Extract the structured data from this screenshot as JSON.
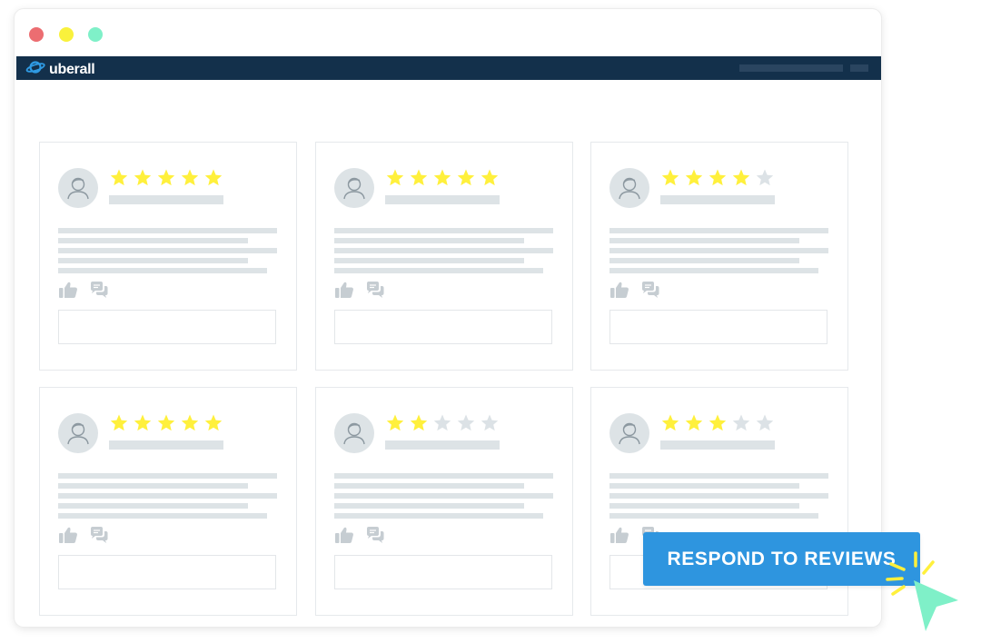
{
  "brand": {
    "name": "uberall",
    "logo_icon": "planet-icon"
  },
  "colors": {
    "navbar": "#13304b",
    "brand_accent": "#2f9be4",
    "star_filled": "#fff03c",
    "star_empty": "#dce2e6",
    "placeholder": "#dde3e6",
    "cta_bg": "#2e95df",
    "cursor": "#7ff0c8",
    "click_spark": "#fff03c",
    "traffic_red": "#ec6d71",
    "traffic_yellow": "#f9f13c",
    "traffic_green": "#7ff0c8"
  },
  "reviews": [
    {
      "rating": 5,
      "max_rating": 5
    },
    {
      "rating": 5,
      "max_rating": 5
    },
    {
      "rating": 4,
      "max_rating": 5
    },
    {
      "rating": 5,
      "max_rating": 5
    },
    {
      "rating": 2,
      "max_rating": 5
    },
    {
      "rating": 3,
      "max_rating": 5
    }
  ],
  "review_icons": {
    "like": "thumbs-up-icon",
    "reply": "comment-bubble-icon"
  },
  "cta": {
    "label": "RESPOND TO REVIEWS"
  }
}
